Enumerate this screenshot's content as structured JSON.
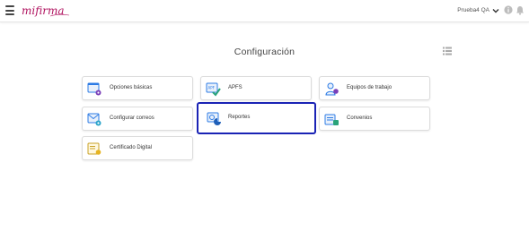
{
  "header": {
    "brand": "mifirma",
    "user_name": "Prueba4 QA",
    "icons": [
      "menu-icon",
      "chevron-down-icon",
      "info-icon",
      "bell-icon"
    ]
  },
  "main": {
    "title": "Configuración",
    "view_toggle_icon": "list-grid-icon",
    "cards": [
      {
        "label": "Opciones básicas",
        "icon": "settings-window-icon"
      },
      {
        "label": "APFS",
        "icon": "seal-check-icon"
      },
      {
        "label": "Equipos de trabajo",
        "icon": "team-users-icon"
      },
      {
        "label": "Configurar correos",
        "icon": "email-settings-icon"
      },
      {
        "label": "Reportes",
        "icon": "report-chart-icon",
        "selected": true
      },
      {
        "label": "Convenios",
        "icon": "agreement-icon"
      },
      {
        "label": "Certificado Digital",
        "icon": "certificate-icon"
      }
    ]
  },
  "colors": {
    "selection_border": "#1a23b5",
    "brand": "#b0125f",
    "icon_blue": "#2c7be5",
    "icon_purple": "#7a3fb8"
  }
}
